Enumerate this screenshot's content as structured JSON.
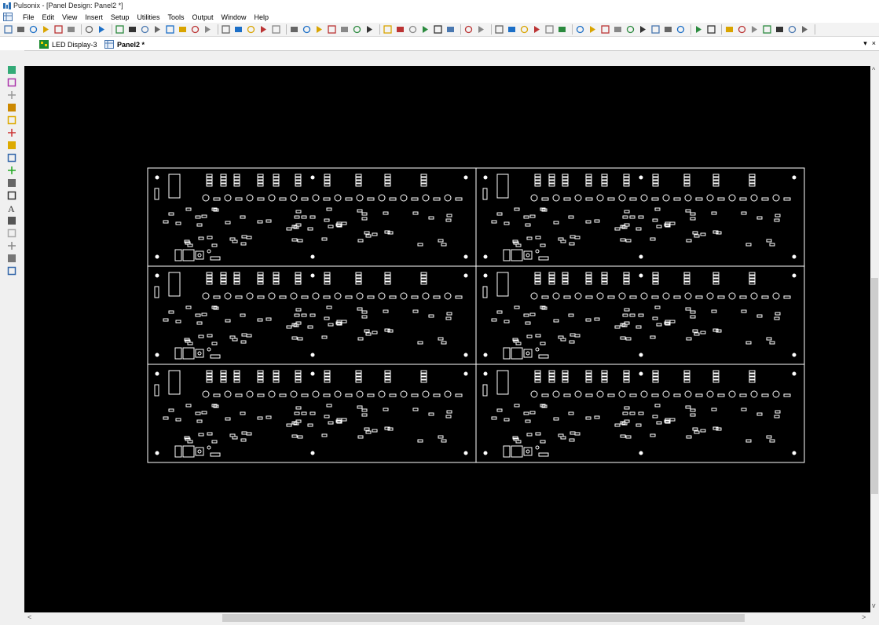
{
  "window": {
    "title": "Pulsonix - [Panel Design: Panel2 *]"
  },
  "menu": {
    "items": [
      "File",
      "Edit",
      "View",
      "Insert",
      "Setup",
      "Utilities",
      "Tools",
      "Output",
      "Window",
      "Help"
    ]
  },
  "tabs": [
    {
      "label": "LED Display-3",
      "active": false,
      "icon": "pcb-icon"
    },
    {
      "label": "Panel2 *",
      "active": true,
      "icon": "panel-icon"
    }
  ],
  "tab_controls": {
    "dropdown": "▾",
    "close": "×"
  },
  "scroll": {
    "up": "^",
    "down": "v",
    "left": "<",
    "right": ">"
  },
  "colors": {
    "canvas": "#000000",
    "outline": "#ffffff",
    "chrome": "#f0f0f0"
  }
}
